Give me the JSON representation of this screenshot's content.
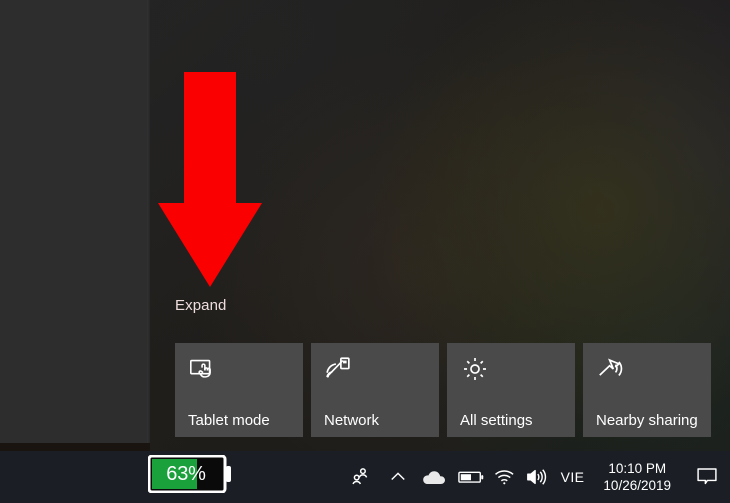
{
  "annotation": {
    "arrow_color": "#fb0000",
    "arrow_name": "red-down-arrow"
  },
  "action_center": {
    "expand_label": "Expand",
    "background_color": "#1e1c1a",
    "tiles": [
      {
        "label": "Tablet mode",
        "icon": "tablet-mode-icon"
      },
      {
        "label": "Network",
        "icon": "network-icon"
      },
      {
        "label": "All settings",
        "icon": "gear-icon"
      },
      {
        "label": "Nearby sharing",
        "icon": "nearby-sharing-icon"
      }
    ]
  },
  "taskbar": {
    "background_color": "#1b1f25",
    "tray_icons": [
      {
        "name": "people-icon"
      },
      {
        "name": "chevron-up-icon"
      },
      {
        "name": "onedrive-cloud-icon"
      },
      {
        "name": "battery-icon"
      },
      {
        "name": "wifi-icon"
      },
      {
        "name": "volume-icon"
      }
    ],
    "language": "VIE",
    "time": "10:10 PM",
    "date": "10/26/2019",
    "action_center_button": "action-center-icon"
  },
  "battery_callout": {
    "percent_label": "63%",
    "percent_value": 63,
    "fill_color": "#1aa13c",
    "empty_color": "#0a0a0a",
    "outline_color": "#ffffff"
  }
}
